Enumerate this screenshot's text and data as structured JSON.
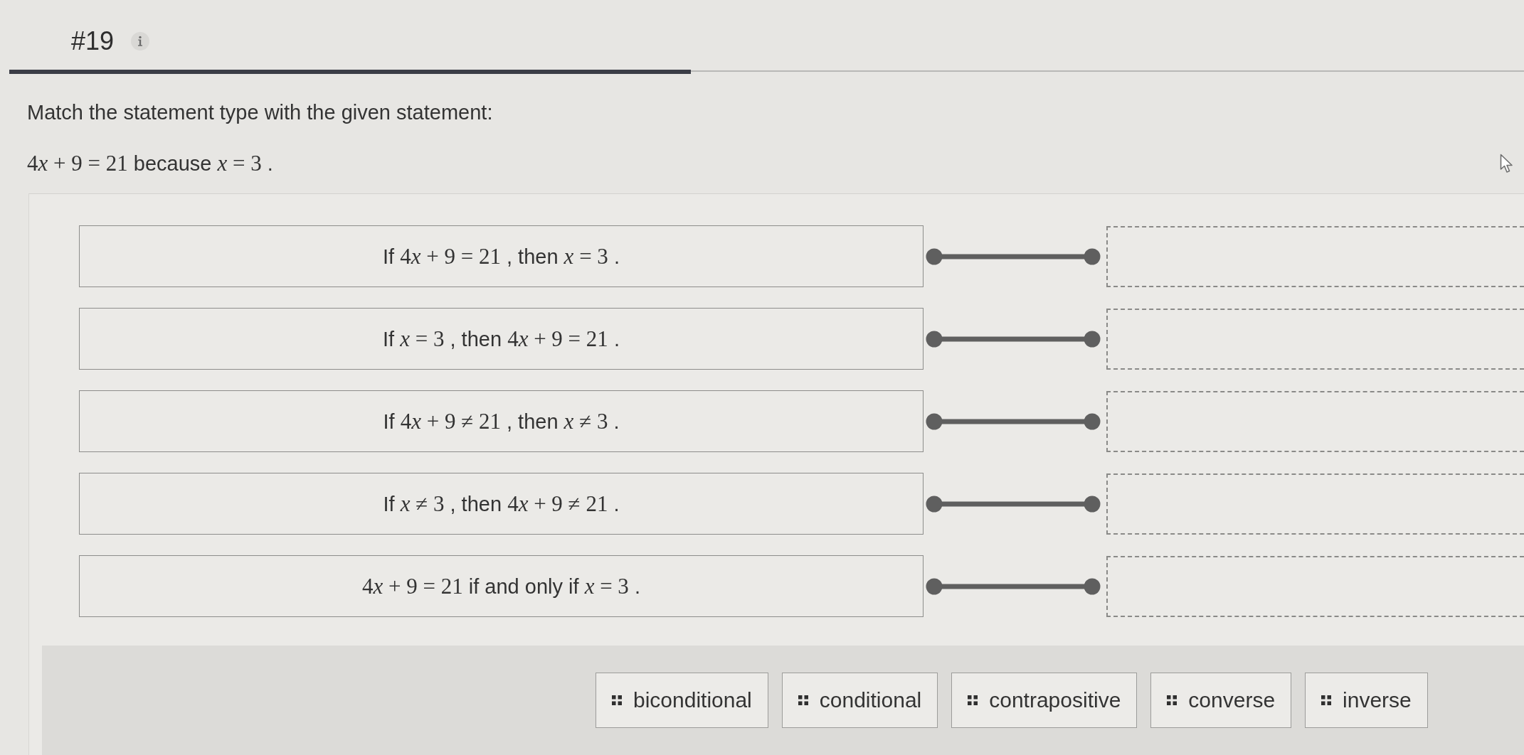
{
  "question": {
    "number": "#19"
  },
  "progress": {
    "level": 0.45
  },
  "prompt": "Match the statement type with the given statement:",
  "given_statement": [
    {
      "kind": "math",
      "text": "4x + 9 = 21"
    },
    {
      "kind": "text",
      "text": "because"
    },
    {
      "kind": "math",
      "text": "x = 3"
    },
    {
      "kind": "text",
      "text": "."
    }
  ],
  "matching_rows": [
    {
      "statement": [
        {
          "kind": "text",
          "text": "If"
        },
        {
          "kind": "math",
          "text": "4x + 9 = 21"
        },
        {
          "kind": "text",
          "text": ", then"
        },
        {
          "kind": "math",
          "text": "x = 3"
        },
        {
          "kind": "text",
          "text": "."
        }
      ]
    },
    {
      "statement": [
        {
          "kind": "text",
          "text": "If"
        },
        {
          "kind": "math",
          "text": "x = 3"
        },
        {
          "kind": "text",
          "text": ", then"
        },
        {
          "kind": "math",
          "text": "4x + 9 = 21"
        },
        {
          "kind": "text",
          "text": "."
        }
      ]
    },
    {
      "statement": [
        {
          "kind": "text",
          "text": "If"
        },
        {
          "kind": "math",
          "text": "4x + 9 ≠ 21"
        },
        {
          "kind": "text",
          "text": ", then"
        },
        {
          "kind": "math",
          "text": "x ≠ 3"
        },
        {
          "kind": "text",
          "text": "."
        }
      ]
    },
    {
      "statement": [
        {
          "kind": "text",
          "text": "If"
        },
        {
          "kind": "math",
          "text": "x ≠ 3"
        },
        {
          "kind": "text",
          "text": ", then"
        },
        {
          "kind": "math",
          "text": "4x + 9 ≠ 21"
        },
        {
          "kind": "text",
          "text": "."
        }
      ]
    },
    {
      "statement": [
        {
          "kind": "math",
          "text": "4x + 9 = 21"
        },
        {
          "kind": "text",
          "text": "if and only if"
        },
        {
          "kind": "math",
          "text": "x = 3"
        },
        {
          "kind": "text",
          "text": "."
        }
      ]
    }
  ],
  "options": [
    "biconditional",
    "conditional",
    "contrapositive",
    "converse",
    "inverse"
  ]
}
